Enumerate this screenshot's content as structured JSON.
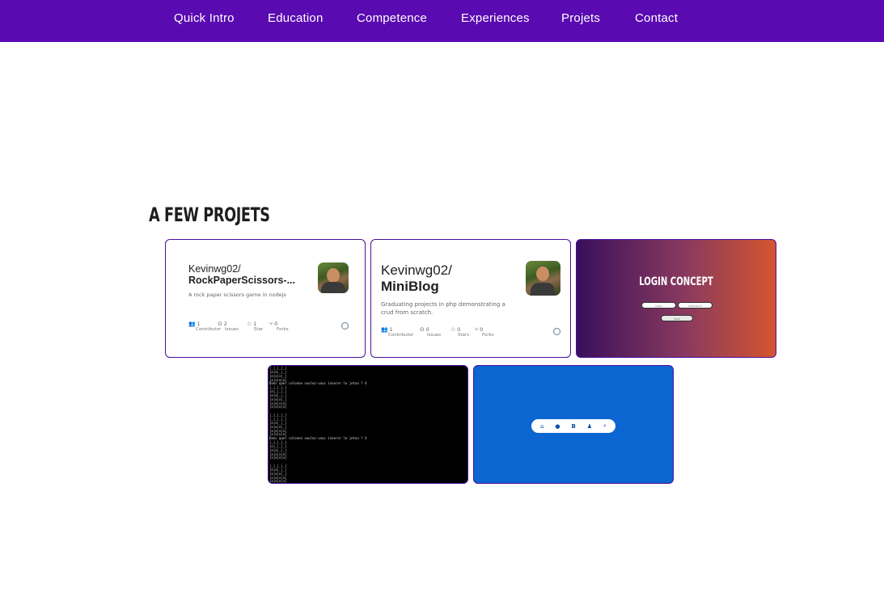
{
  "nav": {
    "items": [
      {
        "label": "Quick Intro"
      },
      {
        "label": "Education"
      },
      {
        "label": "Competence"
      },
      {
        "label": "Experiences"
      },
      {
        "label": "Projets"
      },
      {
        "label": "Contact"
      }
    ]
  },
  "section": {
    "title": "A FEW PROJETS"
  },
  "projects": {
    "rps": {
      "owner": "Kevinwg02/",
      "repo": "RockPaperScissors-...",
      "description": "A rock paper scissors game in nodejs",
      "stats": [
        {
          "value": "1",
          "label": "Contributor",
          "icon": "people-icon"
        },
        {
          "value": "2",
          "label": "Issues",
          "icon": "issue-icon"
        },
        {
          "value": "1",
          "label": "Star",
          "icon": "star-icon"
        },
        {
          "value": "0",
          "label": "Forks",
          "icon": "fork-icon"
        }
      ]
    },
    "miniblog": {
      "owner": "Kevinwg02/",
      "repo": "MiniBlog",
      "description": "Graduating projects in php demonstrating a crud from scratch.",
      "stats": [
        {
          "value": "1",
          "label": "Contributor",
          "icon": "people-icon"
        },
        {
          "value": "0",
          "label": "Issues",
          "icon": "issue-icon"
        },
        {
          "value": "0",
          "label": "Stars",
          "icon": "star-icon"
        },
        {
          "value": "0",
          "label": "Forks",
          "icon": "fork-icon"
        }
      ]
    },
    "login": {
      "title": "LOGIN CONCEPT",
      "login_placeholder": "login",
      "password_placeholder": "password",
      "button": "login"
    },
    "terminal": {
      "lines": [
        "|_|_|_|_|",
        "|o|x|_|_|",
        "|o|x|x|_|",
        "|x|o|o|o|",
        "Dans quel colonne voulez-vous inserer le jeton ? 4",
        "|_|_|_|_|",
        "|o|_|_|_|",
        "|o|x|_|_|",
        "|x|o|x|_|",
        "|x|o|x|o|",
        "|x|o|o|x|",
        "",
        "|_|_|_|_|",
        "|_|_|_|_|",
        "|o|x|_|_|",
        "|o|x|o|_|",
        "|x|o|x|x|",
        "|x|o|o|o|",
        "Dans quel colonne voulez-vous inserer le jeton ? 4",
        "|_|_|_|_|",
        "|o|_|_|_|",
        "|o|x|_|_|",
        "|x|o|x|o|",
        "|x|o|o|x|",
        "",
        "|_|_|_|_|",
        "|o|x|_|_|",
        "|o|x|o|_|",
        "|x|o|x|o|",
        "|x|o|o|x|",
        "Dans quel colonne voulez-vous inserer le jeton ? |"
      ]
    },
    "navbar_icons": [
      "home-icon",
      "user-icon",
      "bootstrap-icon",
      "people-icon",
      "search-icon"
    ]
  },
  "colors": {
    "nav_bg": "#5a0ab1",
    "card_border": "#4b0fa0",
    "blue_card": "#0b66d1"
  }
}
